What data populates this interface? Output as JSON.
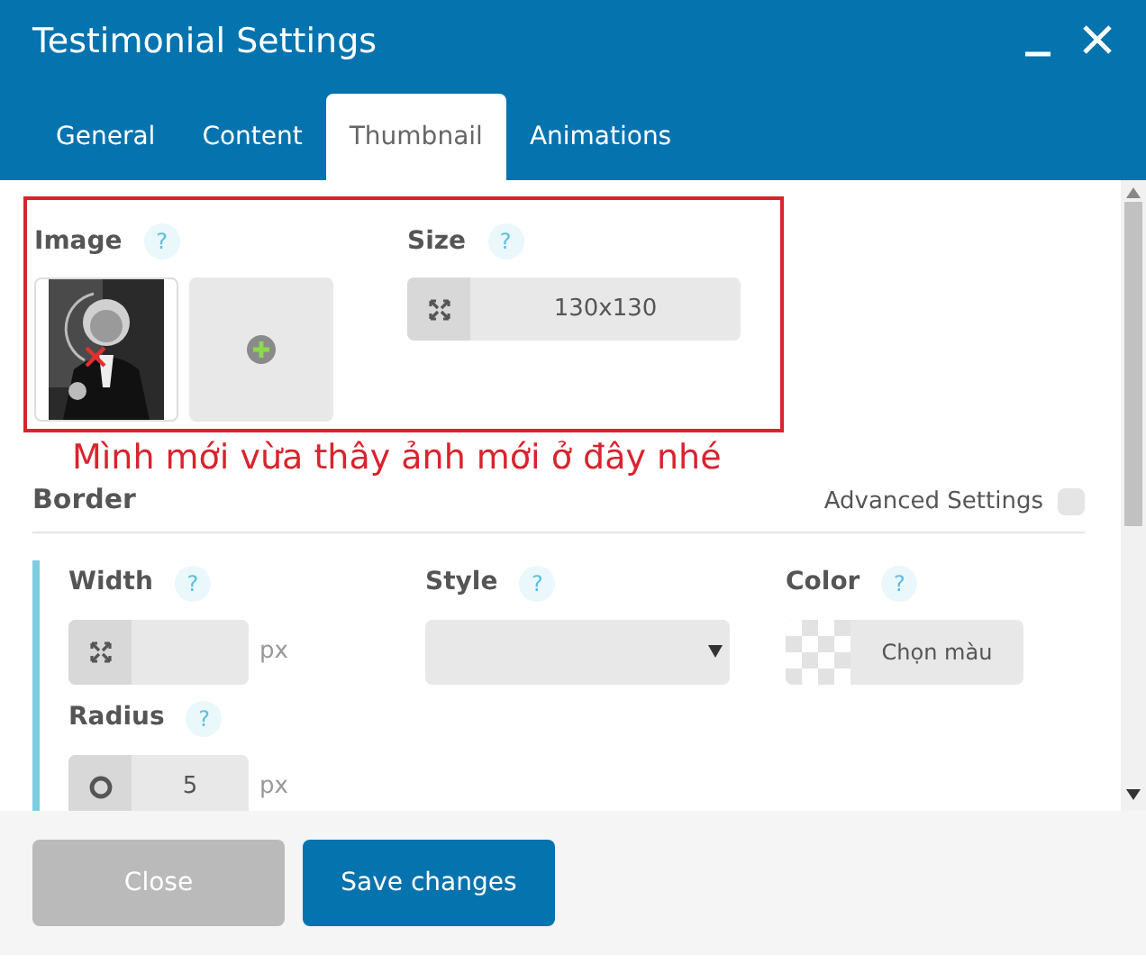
{
  "window": {
    "title": "Testimonial Settings"
  },
  "tabs": [
    {
      "label": "General",
      "selected": false
    },
    {
      "label": "Content",
      "selected": false
    },
    {
      "label": "Thumbnail",
      "selected": true
    },
    {
      "label": "Animations",
      "selected": false
    }
  ],
  "thumbnail": {
    "image_label": "Image",
    "image_help": "?",
    "size_label": "Size",
    "size_help": "?",
    "size_value": "130x130"
  },
  "annotation": "Mình mới vừa thây ảnh mới ở đây nhé",
  "border": {
    "title": "Border",
    "advanced_label": "Advanced Settings",
    "advanced_checked": false,
    "width_label": "Width",
    "width_help": "?",
    "width_unit": "px",
    "style_label": "Style",
    "style_help": "?",
    "color_label": "Color",
    "color_help": "?",
    "color_button": "Chọn màu",
    "radius_label": "Radius",
    "radius_help": "?",
    "radius_value": "5",
    "radius_unit": "px"
  },
  "buttons": [
    {
      "label": "Close",
      "kind": "secondary"
    },
    {
      "label": "Save changes",
      "kind": "primary"
    }
  ]
}
